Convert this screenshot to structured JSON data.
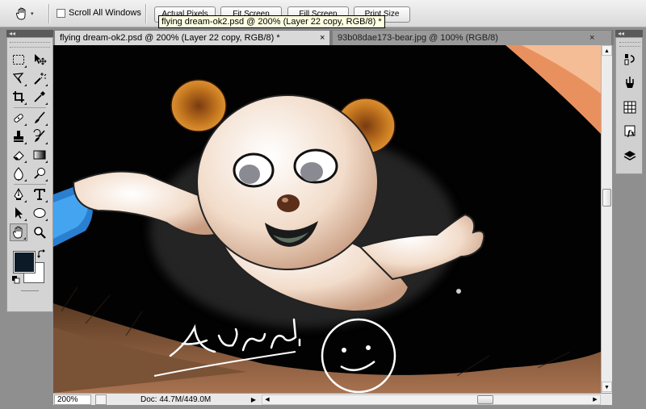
{
  "options_bar": {
    "hand_tool_icon": "hand-icon",
    "scroll_all_windows_label": "Scroll All Windows",
    "scroll_all_windows_checked": false,
    "buttons": [
      "Actual Pixels",
      "Fit Screen",
      "Fill Screen",
      "Print Size"
    ]
  },
  "tooltip": "flying dream-ok2.psd @ 200% (Layer 22 copy, RGB/8) *",
  "panels": {
    "collapse_glyph_left": "◂◂",
    "collapse_glyph_right": "◂◂"
  },
  "tabs": [
    {
      "label": "flying dream-ok2.psd @ 200% (Layer 22 copy, RGB/8) *",
      "close": "×",
      "active": true
    },
    {
      "label": "93b08dae173-bear.jpg @ 100% (RGB/8)",
      "close": "×",
      "active": false
    }
  ],
  "tools": [
    "rectangular-marquee-icon",
    "move-icon",
    "lasso-icon",
    "magic-wand-icon",
    "crop-icon",
    "eyedropper-icon",
    "spot-healing-icon",
    "brush-icon",
    "clone-stamp-icon",
    "history-brush-icon",
    "eraser-icon",
    "gradient-icon",
    "blur-icon",
    "dodge-icon",
    "pen-icon",
    "type-icon",
    "path-selection-icon",
    "ellipse-icon",
    "hand-icon",
    "zoom-icon"
  ],
  "active_tool": "hand-icon",
  "colors": {
    "foreground": "#0c1a28",
    "background": "#ffffff"
  },
  "status": {
    "zoom": "200%",
    "doc_size": "Doc: 44.7M/449.0M",
    "arrow": "▶"
  },
  "scroll": {
    "up": "▲",
    "down": "▼",
    "left": "◀",
    "right": "▶"
  },
  "dock_icons": [
    "history-icon",
    "actions-icon",
    "swatches-icon",
    "styles-fx-icon",
    "layers-icon"
  ]
}
